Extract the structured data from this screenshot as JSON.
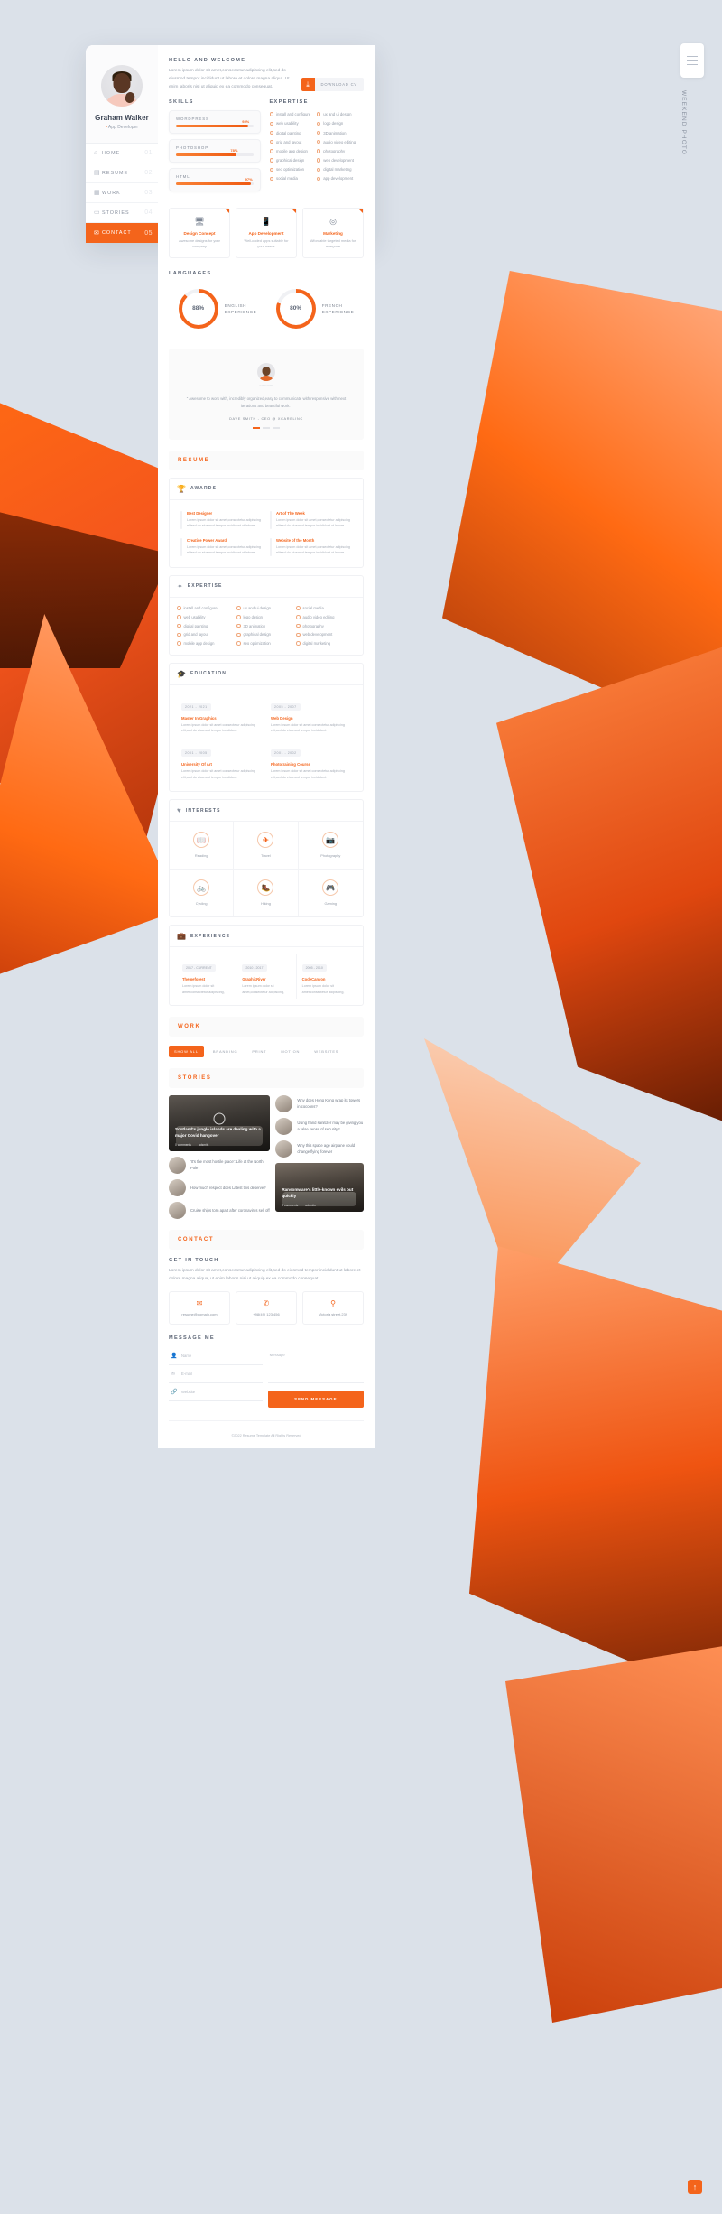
{
  "rail": {
    "menu_icon": "hamburger-icon",
    "vertical_label": "Weekend Photo"
  },
  "profile": {
    "name": "Graham Walker",
    "role": "App Developer",
    "add_button": "+",
    "nav": [
      {
        "icon": "home-icon",
        "label": "HOME",
        "number": "01",
        "active": false
      },
      {
        "icon": "resume-icon",
        "label": "RESUME",
        "number": "02",
        "active": false
      },
      {
        "icon": "work-icon",
        "label": "WORK",
        "number": "03",
        "active": false
      },
      {
        "icon": "stories-icon",
        "label": "STORIES",
        "number": "04",
        "active": false
      },
      {
        "icon": "contact-icon",
        "label": "CONTACT",
        "number": "05",
        "active": true
      }
    ]
  },
  "hello": {
    "title": "HELLO AND WELCOME",
    "text": "Lorem ipsum dolor sit amet,consectetur adipiscing elit,sed do eiusmod tempor incididunt ut labore et dolore magna aliqua. Ut enim laboris nisi ut aliquip ex ea commodo consequat.",
    "download_label": "DOWNLOAD CV",
    "download_icon": "download-icon"
  },
  "skills": {
    "title": "SKILLS",
    "items": [
      {
        "name": "WORDPRESS",
        "value": 93,
        "label": "93%"
      },
      {
        "name": "PHOTOSHOP",
        "value": 78,
        "label": "78%"
      },
      {
        "name": "HTML",
        "value": 97,
        "label": "97%"
      }
    ]
  },
  "expertise": {
    "title": "EXPERTISE",
    "items": [
      "install and configure",
      "ux and ui design",
      "web usability",
      "logo design",
      "digital painting",
      "3D animation",
      "grid and layout",
      "audio video editing",
      "mobile app design",
      "photography",
      "graphical design",
      "web development",
      "seo optimization",
      "digital marketing",
      "social media",
      "app development"
    ]
  },
  "services": [
    {
      "icon": "monitor-icon",
      "title": "Design Concept",
      "desc": "Awesome designs for your company"
    },
    {
      "icon": "mobile-icon",
      "title": "App Development",
      "desc": "Well-coded apps suitable for your needs"
    },
    {
      "icon": "target-icon",
      "title": "Marketing",
      "desc": "Affordable targeted media for everyone"
    }
  ],
  "languages": {
    "title": "LANGUAGES",
    "items": [
      {
        "value": 88,
        "label": "88%",
        "name": "ENGLISH",
        "sub": "EXPERIENCE"
      },
      {
        "value": 80,
        "label": "80%",
        "name": "FRENCH",
        "sub": "EXPERIENCE"
      }
    ]
  },
  "testimonial": {
    "avatar_tag": "testimonials",
    "quote": "\" Awesome to work with, incredibly organized,easy to communicate with,responsive with next iterations and beautiful work.\"",
    "author": "DAVE SMITH - CEO @ XCARELINC"
  },
  "resume": {
    "band": "RESUME"
  },
  "awards": {
    "title": "AWARDS",
    "icon": "trophy-icon",
    "items": [
      {
        "title": "Best Designer",
        "desc": "Lorem ipsum dolor sit amet,consectetur adipiscing elitsed do eiusmod tempor incididunt ut labore"
      },
      {
        "title": "Art of The Week",
        "desc": "Lorem ipsum dolor sit amet,consectetur adipiscing elitsed do eiusmod tempor incididunt ut labore"
      },
      {
        "title": "Creative Power Award",
        "desc": "Lorem ipsum dolor sit amet,consectetur adipiscing elitsed do eiusmod tempor incididunt ut labore"
      },
      {
        "title": "Website of the Month",
        "desc": "Lorem ipsum dolor sit amet,consectetur adipiscing elitsed do eiusmod tempor incididunt ut labore"
      }
    ]
  },
  "expertise2": {
    "title": "EXPERTISE",
    "icon": "star-icon",
    "col1": [
      "install and configure",
      "web usability",
      "digital painting",
      "grid and layout",
      "mobile app design"
    ],
    "col2": [
      "ux and ui design",
      "logo design",
      "3D animation",
      "graphical design",
      "seo optimization"
    ],
    "col3": [
      "social media",
      "audio video editing",
      "photography",
      "web development",
      "digital marketing"
    ]
  },
  "education": {
    "title": "EDUCATION",
    "icon": "cap-icon",
    "items": [
      {
        "years": "2021 - 2021",
        "title": "Master In Graphics",
        "desc": "Lorem ipsum dolor sit amet consectetur adipiscing elit,sed do eiusmod tempor incididunt."
      },
      {
        "years": "2005 - 2007",
        "title": "Web Design",
        "desc": "Lorem ipsum dolor sit amet consectetur adipiscing elit,sed do eiusmod tempor incididunt."
      },
      {
        "years": "2001 - 2005",
        "title": "University Of Art",
        "desc": "Lorem ipsum dolor sit amet consectetur adipiscing elit,sed do eiusmod tempor incididunt."
      },
      {
        "years": "2001 - 2002",
        "title": "Phototraining Course",
        "desc": "Lorem ipsum dolor sit amet consectetur adipiscing elit,sed do eiusmod tempor incididunt."
      }
    ]
  },
  "interests": {
    "title": "INTERESTS",
    "icon": "heart-icon",
    "items": [
      {
        "icon": "book-icon",
        "label": "Reading"
      },
      {
        "icon": "plane-icon",
        "label": "Travel"
      },
      {
        "icon": "camera-icon",
        "label": "Photography"
      },
      {
        "icon": "bike-icon",
        "label": "Cycling"
      },
      {
        "icon": "hiking-icon",
        "label": "Hiking"
      },
      {
        "icon": "gamepad-icon",
        "label": "Gaming"
      }
    ]
  },
  "experience": {
    "title": "EXPERIENCE",
    "icon": "briefcase-icon",
    "items": [
      {
        "years": "2017 - CURRENT",
        "title": "Themeforest",
        "desc": "Lorem ipsum dolor sit amet,consectetur adipiscing,"
      },
      {
        "years": "2010 - 2017",
        "title": "GraphicRiver",
        "desc": "Lorem ipsum dolor sit amet,consectetur adipiscing,"
      },
      {
        "years": "2005 - 2010",
        "title": "CodeCanyon",
        "desc": "Lorem ipsum dolor sit amet,consectetur adipiscing,"
      }
    ]
  },
  "work": {
    "band": "WORK",
    "filters": [
      {
        "label": "SHOW ALL",
        "active": true
      },
      {
        "label": "BRANDING",
        "active": false
      },
      {
        "label": "PRINT",
        "active": false
      },
      {
        "label": "MOTION",
        "active": false
      },
      {
        "label": "WEBSITES",
        "active": false
      }
    ]
  },
  "stories": {
    "band": "STORIES",
    "featured": [
      {
        "title": "Scotland's jungle islands are dealing with a major Covid hangover",
        "comments": "0 comments",
        "author": "adsmits"
      },
      {
        "title": "Ransomware's little-known evils out quickly",
        "comments": "0 comments",
        "author": "adsmits"
      }
    ],
    "minis": [
      {
        "title": "Why does Hong Kong wrap its towers in cocoons?",
        "highlight": ""
      },
      {
        "title": "Using hand sanitizer may be giving you a false sense of security?",
        "highlight": ""
      },
      {
        "title": "'It's the most hostile place': Life at the North Pole",
        "highlight": ""
      },
      {
        "title": "Why this space age airplane could change flying forever",
        "highlight": ""
      },
      {
        "title": "How much respect does Latest this deserve?",
        "highlight": ""
      },
      {
        "title": "Cruise ships torn apart after coronavirus sell off",
        "highlight": ""
      }
    ]
  },
  "contact": {
    "band": "CONTACT",
    "title": "GET IN TOUCH",
    "text": "Lorem ipsum dolor sit amet,consectetur adipiscing elit,sed do eiusmod tempor incididunt ut labore et dolore magna aliqua, ut enim laboris nisi ut aliquip ex ea commodo consequat.",
    "items": [
      {
        "icon": "mail-icon",
        "value": "resume@domain.com"
      },
      {
        "icon": "phone-icon",
        "value": "+98(49) 123 456"
      },
      {
        "icon": "pin-icon",
        "value": "Victoria street,239"
      }
    ],
    "form_title": "MESSAGE ME",
    "fields": [
      {
        "icon": "user-icon",
        "placeholder": "Name"
      },
      {
        "icon": "mail-icon",
        "placeholder": "E-mail"
      },
      {
        "icon": "link-icon",
        "placeholder": "Website"
      }
    ],
    "message_placeholder": "Message",
    "send_label": "SEND MESSAGE"
  },
  "footer": {
    "text": "©2022 Resume Template All Rights Reserved"
  },
  "fab": {
    "icon": "arrow-up-icon",
    "label": "↑"
  },
  "colors": {
    "accent": "#f4641b",
    "bg": "#dbe1e9",
    "text": "#5d6676"
  }
}
